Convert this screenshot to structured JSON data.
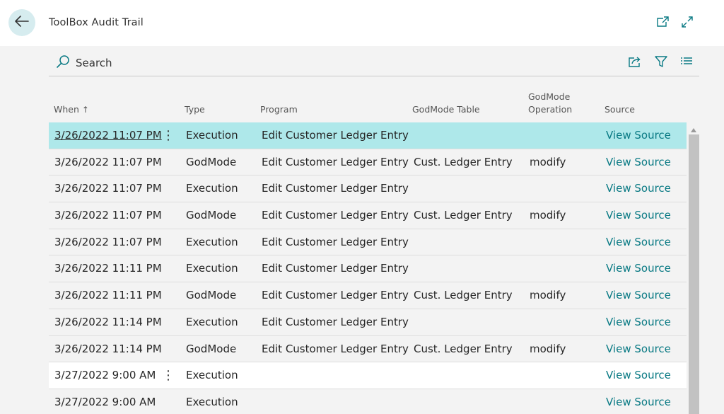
{
  "header": {
    "title": "ToolBox Audit Trail"
  },
  "toolbar": {
    "search_label": "Search"
  },
  "icons": {
    "back": "arrow-left-icon",
    "open_new_window": "open-in-new-window-icon",
    "expand": "expand-icon",
    "search": "search-icon",
    "share": "share-icon",
    "filter": "filter-icon",
    "list_view": "list-view-icon"
  },
  "colors": {
    "accent_link": "#0a7a84",
    "selected_row": "#aee8ea",
    "back_button": "#d6ecef"
  },
  "table": {
    "columns": {
      "when": "When",
      "sort_indicator": "↑",
      "type": "Type",
      "program": "Program",
      "godmode_table_line1": "GodMode Table",
      "godmode_operation_line1": "GodMode",
      "godmode_operation_line2": "Operation",
      "source": "Source"
    },
    "rows": [
      {
        "when": "3/26/2022 11:07 PM",
        "type": "Execution",
        "program": "Edit Customer Ledger Entry",
        "table": "",
        "operation": "",
        "source": "View Source"
      },
      {
        "when": "3/26/2022 11:07 PM",
        "type": "GodMode",
        "program": "Edit Customer Ledger Entry",
        "table": "Cust. Ledger Entry",
        "operation": "modify",
        "source": "View Source"
      },
      {
        "when": "3/26/2022 11:07 PM",
        "type": "Execution",
        "program": "Edit Customer Ledger Entry",
        "table": "",
        "operation": "",
        "source": "View Source"
      },
      {
        "when": "3/26/2022 11:07 PM",
        "type": "GodMode",
        "program": "Edit Customer Ledger Entry",
        "table": "Cust. Ledger Entry",
        "operation": "modify",
        "source": "View Source"
      },
      {
        "when": "3/26/2022 11:07 PM",
        "type": "Execution",
        "program": "Edit Customer Ledger Entry",
        "table": "",
        "operation": "",
        "source": "View Source"
      },
      {
        "when": "3/26/2022 11:11 PM",
        "type": "Execution",
        "program": "Edit Customer Ledger Entry",
        "table": "",
        "operation": "",
        "source": "View Source"
      },
      {
        "when": "3/26/2022 11:11 PM",
        "type": "GodMode",
        "program": "Edit Customer Ledger Entry",
        "table": "Cust. Ledger Entry",
        "operation": "modify",
        "source": "View Source"
      },
      {
        "when": "3/26/2022 11:14 PM",
        "type": "Execution",
        "program": "Edit Customer Ledger Entry",
        "table": "",
        "operation": "",
        "source": "View Source"
      },
      {
        "when": "3/26/2022 11:14 PM",
        "type": "GodMode",
        "program": "Edit Customer Ledger Entry",
        "table": "Cust. Ledger Entry",
        "operation": "modify",
        "source": "View Source"
      },
      {
        "when": "3/27/2022 9:00 AM",
        "type": "Execution",
        "program": "",
        "table": "",
        "operation": "",
        "source": "View Source"
      },
      {
        "when": "3/27/2022 9:00 AM",
        "type": "Execution",
        "program": "",
        "table": "",
        "operation": "",
        "source": "View Source"
      }
    ]
  }
}
